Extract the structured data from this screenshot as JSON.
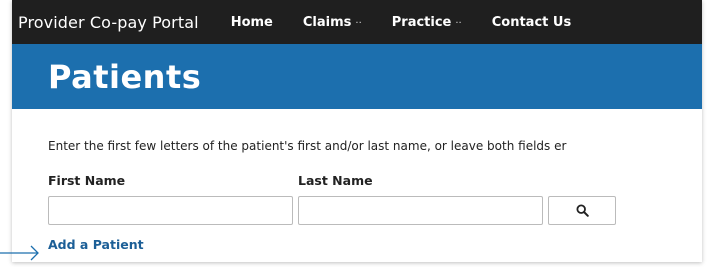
{
  "app": {
    "title": "Provider Co-pay Portal"
  },
  "nav": {
    "items": [
      {
        "label": "Home",
        "caret": ""
      },
      {
        "label": "Claims",
        "caret": "··"
      },
      {
        "label": "Practice",
        "caret": "··"
      },
      {
        "label": "Contact Us",
        "caret": ""
      }
    ]
  },
  "page": {
    "title": "Patients"
  },
  "search": {
    "instructions": "Enter the first few letters of the patient's first and/or last name, or leave both fields er",
    "first_name_label": "First Name",
    "last_name_label": "Last Name",
    "first_name_value": "",
    "last_name_value": "",
    "button_icon": "search-icon"
  },
  "actions": {
    "add_patient_label": "Add a Patient"
  },
  "colors": {
    "accent": "#1c6fae",
    "nav_bg": "#1f1f1f",
    "link": "#1c5f97",
    "arrow": "#1c6fae"
  }
}
